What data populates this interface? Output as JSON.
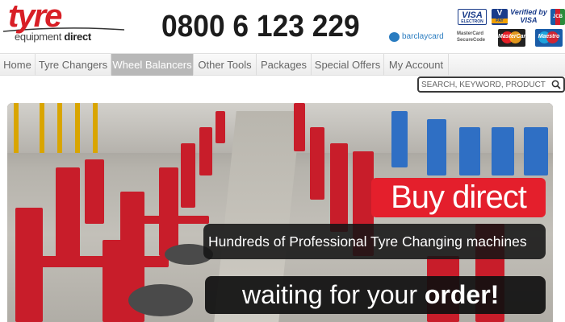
{
  "header": {
    "logo": {
      "main": "tyre",
      "sub_plain": "equipment",
      "sub_bold": "direct"
    },
    "phone": "0800 6 123 229",
    "payment": {
      "visa": "VISA",
      "visa_sub": "ELECTRON",
      "vpay": "V",
      "vpay_sub": "PAY",
      "verified_line1": "Verified by",
      "verified_line2": "VISA",
      "jcb": "JCB",
      "barclaycard": "barclaycard",
      "securecode_line1": "MasterCard",
      "securecode_line2": "SecureCode",
      "mastercard": "MasterCard",
      "maestro": "Maestro"
    }
  },
  "nav": {
    "items": [
      {
        "label": "Home"
      },
      {
        "label": "Tyre Changers"
      },
      {
        "label": "Wheel Balancers"
      },
      {
        "label": "Other Tools"
      },
      {
        "label": "Packages"
      },
      {
        "label": "Special Offers"
      },
      {
        "label": "My Account"
      }
    ],
    "active": "Wheel Balancers"
  },
  "search": {
    "placeholder": "SEARCH, KEYWORD, PRODUCT",
    "value": ""
  },
  "banner": {
    "headline": "Buy direct",
    "line1": "Hundreds of Professional Tyre Changing machines",
    "line2_plain": "waiting for your ",
    "line2_bold": "order!"
  },
  "colors": {
    "brand_red": "#d81f26",
    "nav_active_bg": "#b8b8b8",
    "banner_red": "#e41f2c"
  }
}
